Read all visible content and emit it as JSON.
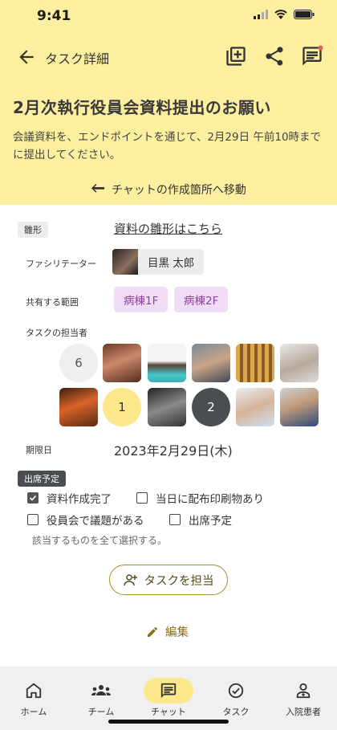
{
  "status": {
    "time": "9:41"
  },
  "appbar": {
    "title": "タスク詳細"
  },
  "task": {
    "title": "2月次執行役員会資料提出のお願い",
    "description": "会議資料を、エンドポイントを通じて、2月29日 午前10時までに提出してください。",
    "chat_link": "チャットの作成箇所へ移動"
  },
  "fields": {
    "template_label": "雛形",
    "template_link": "資料の雛形はこちら",
    "facilitator_label": "ファシリテーター",
    "facilitator_name": "目黒 太郎",
    "scope_label": "共有する範囲",
    "scopes": [
      "病棟1F",
      "病棟2F"
    ],
    "assignees_label": "タスクの担当者",
    "assignee_counts": [
      "6",
      "1",
      "2"
    ],
    "due_label": "期限日",
    "due_value": "2023年2月29日(木)",
    "attendance_label": "出席予定"
  },
  "checkboxes": [
    {
      "label": "資料作成完了",
      "checked": true
    },
    {
      "label": "当日に配布印刷物あり",
      "checked": false
    },
    {
      "label": "役員会で議題がある",
      "checked": false
    },
    {
      "label": "出席予定",
      "checked": false
    }
  ],
  "hint": "該当するものを全て選択する。",
  "actions": {
    "assign": "タスクを担当",
    "edit": "編集"
  },
  "nav": [
    {
      "label": "ホーム",
      "icon": "home-icon"
    },
    {
      "label": "チーム",
      "icon": "team-icon"
    },
    {
      "label": "チャット",
      "icon": "chat-icon",
      "active": true
    },
    {
      "label": "タスク",
      "icon": "task-check-icon"
    },
    {
      "label": "入院患者",
      "icon": "patient-icon"
    }
  ],
  "colors": {
    "header_bg": "#fcef9f",
    "chip_purple_bg": "#f1dcf6",
    "chip_purple_text": "#8d3fa6",
    "accent_yellow": "#fce78a",
    "gold": "#a88a2a"
  }
}
